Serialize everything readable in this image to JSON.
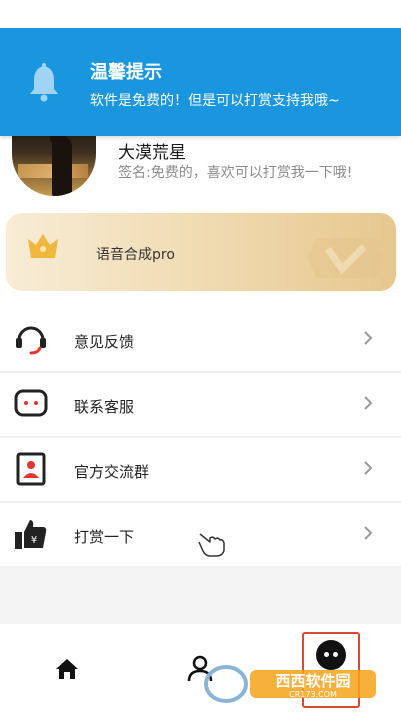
{
  "notification": {
    "title": "温馨提示",
    "message": "软件是免费的！但是可以打赏支持我哦~",
    "icon": "bell-icon",
    "background": "#1a96df"
  },
  "profile": {
    "name": "大漠荒星",
    "signature": "签名:免费的，喜欢可以打赏我一下哦!"
  },
  "vip": {
    "label": "语音合成pro",
    "icon": "crown-icon"
  },
  "menu": {
    "items": [
      {
        "label": "意见反馈",
        "icon": "headset-icon"
      },
      {
        "label": "联系客服",
        "icon": "chat-bubble-icon"
      },
      {
        "label": "官方交流群",
        "icon": "group-card-icon"
      },
      {
        "label": "打赏一下",
        "icon": "thumbs-up-money-icon"
      }
    ]
  },
  "tabbar": {
    "tabs": [
      {
        "name": "home",
        "icon": "home-icon"
      },
      {
        "name": "user",
        "icon": "user-icon"
      },
      {
        "name": "mine",
        "icon": "mascot-icon",
        "selected": true
      }
    ],
    "highlight_color": "#d94a36"
  },
  "watermark": {
    "site": "西西软件园",
    "domain": "CR173.COM"
  }
}
